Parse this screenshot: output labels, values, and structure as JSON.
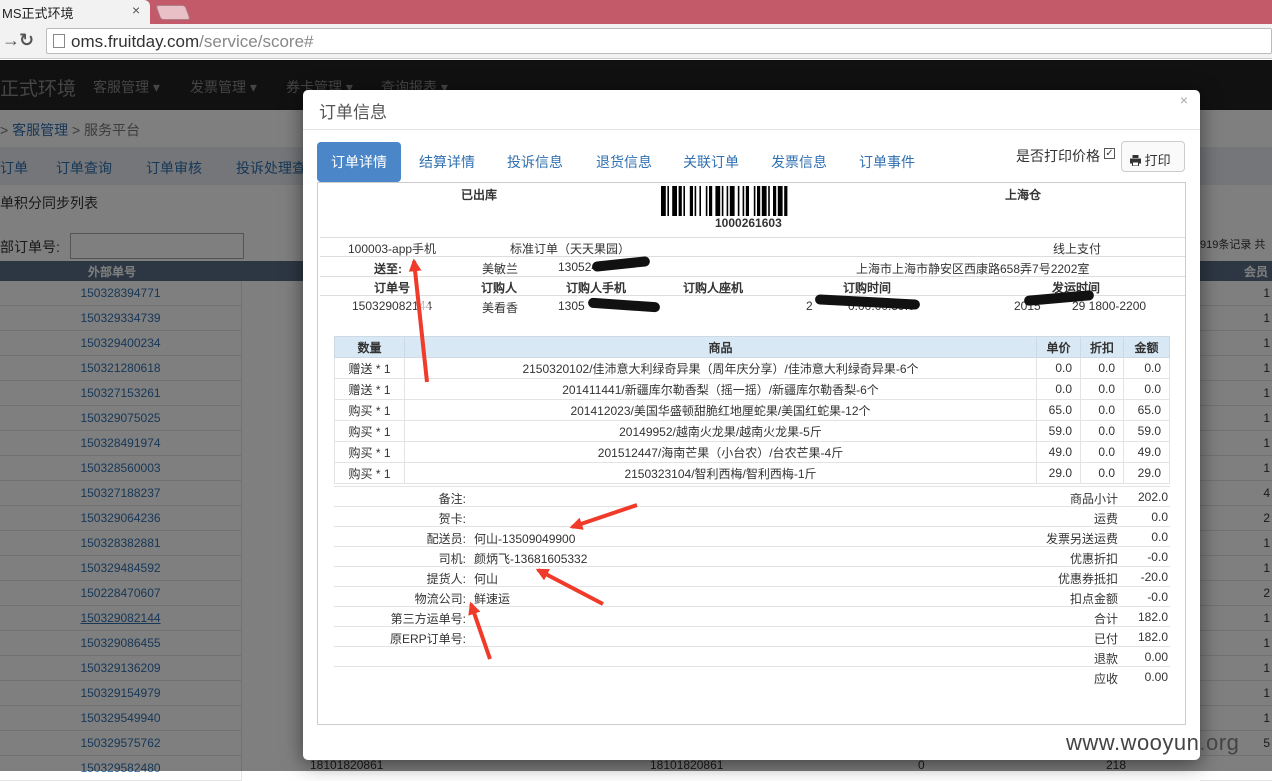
{
  "browser": {
    "tab_title": "MS正式环境",
    "tab_close": "×",
    "url_host": "oms.fruitday.com",
    "url_path": "/service/score#"
  },
  "app": {
    "brand": "正式环境",
    "nav": [
      "客服管理 ▾",
      "发票管理 ▾",
      "券卡管理 ▾",
      "查询报表 ▾"
    ],
    "breadcrumb": {
      "sep": ">",
      "link": "客服管理",
      "sep2": ">",
      "current": "服务平台"
    },
    "subnav": [
      "订单",
      "订单查询",
      "订单审核",
      "投诉处理查"
    ],
    "list_title": "单积分同步列表",
    "search_label": "部订单号:",
    "records_info": "919条记录 共",
    "table_header_left": "外部单号",
    "table_header_right": "会员",
    "orders": [
      "150328394771",
      "150329334739",
      "150329400234",
      "150321280618",
      "150327153261",
      "150329075025",
      "150328491974",
      "150328560003",
      "150327188237",
      "150329064236",
      "150328382881",
      "150329484592",
      "150228470607",
      "150329082144",
      "150329086455",
      "150329136209",
      "150329154979",
      "150329549940",
      "150329575762",
      "150329582480"
    ],
    "right_values": [
      "1",
      "1",
      "1",
      "1",
      "1",
      "1",
      "1",
      "1",
      "4",
      "2",
      "1",
      "1",
      "2",
      "1",
      "1",
      "1",
      "1",
      "1",
      "5",
      ""
    ],
    "last_row": {
      "a": "18101820861",
      "b": "18101820861",
      "c": "0",
      "d": "218"
    }
  },
  "modal": {
    "title": "订单信息",
    "close": "×",
    "tabs": [
      "订单详情",
      "结算详情",
      "投诉信息",
      "退货信息",
      "关联订单",
      "发票信息",
      "订单事件"
    ],
    "print_price_label": "是否打印价格",
    "print_checked": "✓",
    "print_button": "打印",
    "print_icon": "printer-icon"
  },
  "order": {
    "status": "已出库",
    "barcode_number": "1000261603",
    "warehouse": "上海仓",
    "channel": "100003-app手机",
    "order_type": "标准订单（天天果园）",
    "payment": "线上支付",
    "ship_to_label": "送至:",
    "ship_name": "美敏兰",
    "ship_phone": "1305247",
    "ship_address": "上海市上海市静安区西康路658弄7号2202室",
    "col_headers": [
      "订单号",
      "订购人",
      "订购人手机",
      "订购人座机",
      "订购时间",
      "发运时间"
    ],
    "order_no": "150329082144",
    "buyer": "美看香",
    "buyer_phone": "1305",
    "order_time_prefix": "2",
    "order_time_suffix": "0:00:00:59.0",
    "ship_time_prefix": "2015",
    "ship_time_suffix": "29 1800-2200"
  },
  "goods": {
    "headers": [
      "数量",
      "商品",
      "单价",
      "折扣",
      "金额"
    ],
    "rows": [
      {
        "qty": "赠送 * 1",
        "name": "2150320102/佳沛意大利绿奇异果（周年庆分享）/佳沛意大利绿奇异果-6个",
        "price": "0.0",
        "discount": "0.0",
        "amount": "0.0"
      },
      {
        "qty": "赠送 * 1",
        "name": "201411441/新疆库尔勒香梨（摇一摇）/新疆库尔勒香梨-6个",
        "price": "0.0",
        "discount": "0.0",
        "amount": "0.0"
      },
      {
        "qty": "购买 * 1",
        "name": "201412023/美国华盛顿甜脆红地厘蛇果/美国红蛇果-12个",
        "price": "65.0",
        "discount": "0.0",
        "amount": "65.0"
      },
      {
        "qty": "购买 * 1",
        "name": "20149952/越南火龙果/越南火龙果-5斤",
        "price": "59.0",
        "discount": "0.0",
        "amount": "59.0"
      },
      {
        "qty": "购买 * 1",
        "name": "201512447/海南芒果（小台农）/台农芒果-4斤",
        "price": "49.0",
        "discount": "0.0",
        "amount": "49.0"
      },
      {
        "qty": "购买 * 1",
        "name": "2150323104/智利西梅/智利西梅-1斤",
        "price": "29.0",
        "discount": "0.0",
        "amount": "29.0"
      }
    ]
  },
  "info": [
    {
      "label": "备注:",
      "value": "",
      "sum_label": "商品小计",
      "sum_value": "202.0"
    },
    {
      "label": "贺卡:",
      "value": "",
      "sum_label": "运费",
      "sum_value": "0.0"
    },
    {
      "label": "配送员:",
      "value": "何山-13509049900",
      "sum_label": "发票另送运费",
      "sum_value": "0.0"
    },
    {
      "label": "司机:",
      "value": "颜炳飞-13681605332",
      "sum_label": "优惠折扣",
      "sum_value": "-0.0"
    },
    {
      "label": "提货人:",
      "value": "何山",
      "sum_label": "优惠券抵扣",
      "sum_value": "-20.0"
    },
    {
      "label": "物流公司:",
      "value": "鲜速运",
      "sum_label": "扣点金额",
      "sum_value": "-0.0"
    },
    {
      "label": "第三方运单号:",
      "value": "",
      "sum_label": "合计",
      "sum_value": "182.0"
    },
    {
      "label": "原ERP订单号:",
      "value": "",
      "sum_label": "已付",
      "sum_value": "182.0"
    },
    {
      "label": "",
      "value": "",
      "sum_label": "退款",
      "sum_value": "0.00"
    },
    {
      "label": "",
      "value": "",
      "sum_label": "应收",
      "sum_value": "0.00"
    }
  ],
  "watermark": "www.wooyun.org",
  "colors": {
    "accent": "#4a86c8",
    "link": "#3070b0",
    "arrow": "#f03a2a",
    "tabstrip": "#c25a6a",
    "navbar": "#222222"
  }
}
